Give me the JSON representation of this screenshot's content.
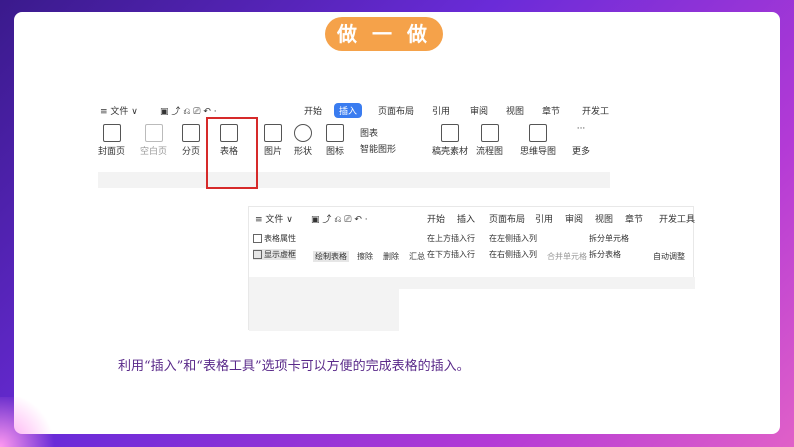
{
  "title": "做 一 做",
  "toolbar1": {
    "menu": [
      "≡ 文件 ∨",
      "开始",
      "插入",
      "页面布局",
      "引用",
      "审阅",
      "视图",
      "章节",
      "开发工"
    ],
    "active_tab": "插入",
    "ribbon": [
      "封面页",
      "空白页",
      "分页",
      "表格",
      "图片",
      "形状",
      "图标",
      "图表",
      "智能图形",
      "稿壳素材",
      "流程图",
      "思维导图",
      "更多"
    ]
  },
  "toolbar2": {
    "menu": [
      "≡ 文件 ∨",
      "开始",
      "插入",
      "页面布局",
      "引用",
      "审阅",
      "视图",
      "章节",
      "开发工具"
    ],
    "ribbon": {
      "table_props": "表格属性",
      "show_gridlines": "显示虚框",
      "draw_table": "绘制表格",
      "erase": "擦除",
      "delete": "删除",
      "summary": "汇总",
      "insert_above": "在上方插入行",
      "insert_below": "在下方插入行",
      "insert_left": "在左侧插入列",
      "insert_right": "在右侧插入列",
      "merge_cells": "合并单元格",
      "split_cells": "拆分单元格",
      "split_table": "拆分表格",
      "auto_adjust": "自动调整"
    }
  },
  "caption": "利用“插入”和“表格工具”选项卡可以方便的完成表格的插入。",
  "colors": {
    "accent": "#f5a24a",
    "highlight_box": "#d62a2a",
    "active_tab": "#3a7cf0"
  }
}
